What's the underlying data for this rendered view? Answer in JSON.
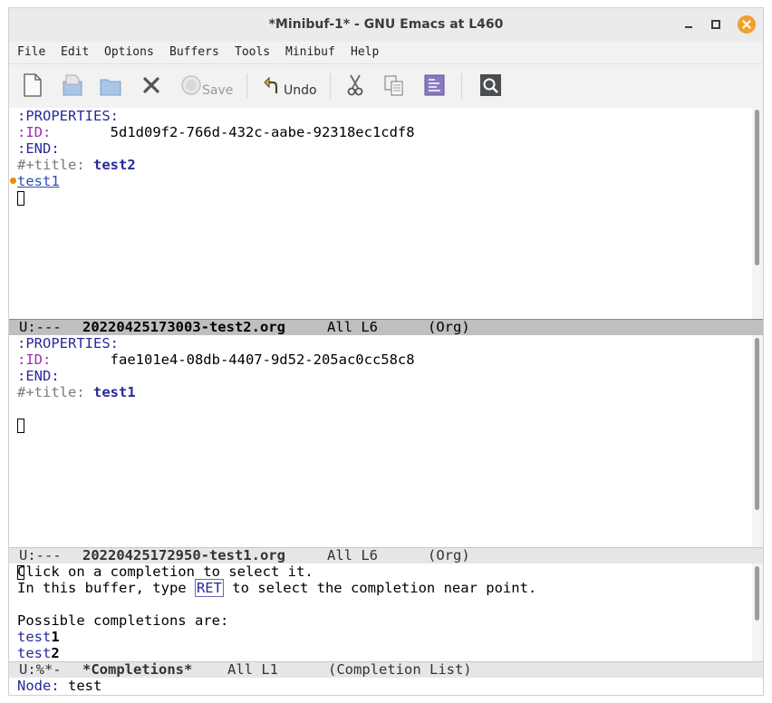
{
  "window": {
    "title": "*Minibuf-1* - GNU Emacs at L460"
  },
  "menubar": {
    "items": [
      "File",
      "Edit",
      "Options",
      "Buffers",
      "Tools",
      "Minibuf",
      "Help"
    ]
  },
  "toolbar": {
    "save_label": "Save",
    "undo_label": "Undo",
    "icons": [
      "new-file-icon",
      "open-file-icon",
      "open-dir-icon",
      "close-icon",
      "save-icon",
      "undo-icon",
      "cut-icon",
      "copy-icon",
      "paste-icon",
      "search-icon"
    ]
  },
  "pane1": {
    "properties": ":PROPERTIES:",
    "id_key": ":ID:",
    "id_value": "5d1d09f2-766d-432c-aabe-92318ec1cdf8",
    "end": ":END:",
    "title_key": "#+title:",
    "title_value": "test2",
    "link": "test1"
  },
  "modeline1": {
    "status": "U:---",
    "buffer": "20220425173003-test2.org",
    "position": "All L6",
    "mode": "(Org)"
  },
  "pane2": {
    "properties": ":PROPERTIES:",
    "id_key": ":ID:",
    "id_value": "fae101e4-08db-4407-9d52-205ac0cc58c8",
    "end": ":END:",
    "title_key": "#+title:",
    "title_value": "test1"
  },
  "modeline2": {
    "status": "U:---",
    "buffer": "20220425172950-test1.org",
    "position": "All L6",
    "mode": "(Org)"
  },
  "completions": {
    "line1": "Click on a completion to select it.",
    "line2_pre": "In this buffer, type ",
    "line2_key": "RET",
    "line2_post": " to select the completion near point.",
    "line3": "Possible completions are:",
    "items": [
      {
        "prefix": "test",
        "suffix": "1"
      },
      {
        "prefix": "test",
        "suffix": "2"
      }
    ]
  },
  "modeline3": {
    "status": "U:%*-",
    "buffer": "*Completions*",
    "position": "All L1",
    "mode": "(Completion List)"
  },
  "minibuffer": {
    "prompt": "Node:",
    "input": "test"
  },
  "colors": {
    "keyword": "#9b2fb3",
    "value": "#2a2a9a",
    "link": "#2d4fb3",
    "close_button": "#f0a030",
    "fringe_marker": "#f08a00"
  }
}
